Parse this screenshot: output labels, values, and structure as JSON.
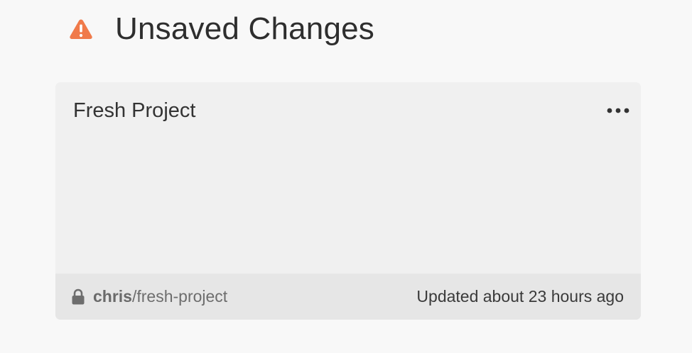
{
  "header": {
    "icon": "warning-triangle-icon",
    "icon_color": "#f07a4a",
    "title": "Unsaved Changes"
  },
  "project_card": {
    "title": "Fresh Project",
    "more_icon": "more-horizontal-icon",
    "footer": {
      "lock_icon": "lock-icon",
      "owner": "chris",
      "separator": "/",
      "repo": "fresh-project",
      "updated": "Updated about 23 hours ago"
    }
  }
}
